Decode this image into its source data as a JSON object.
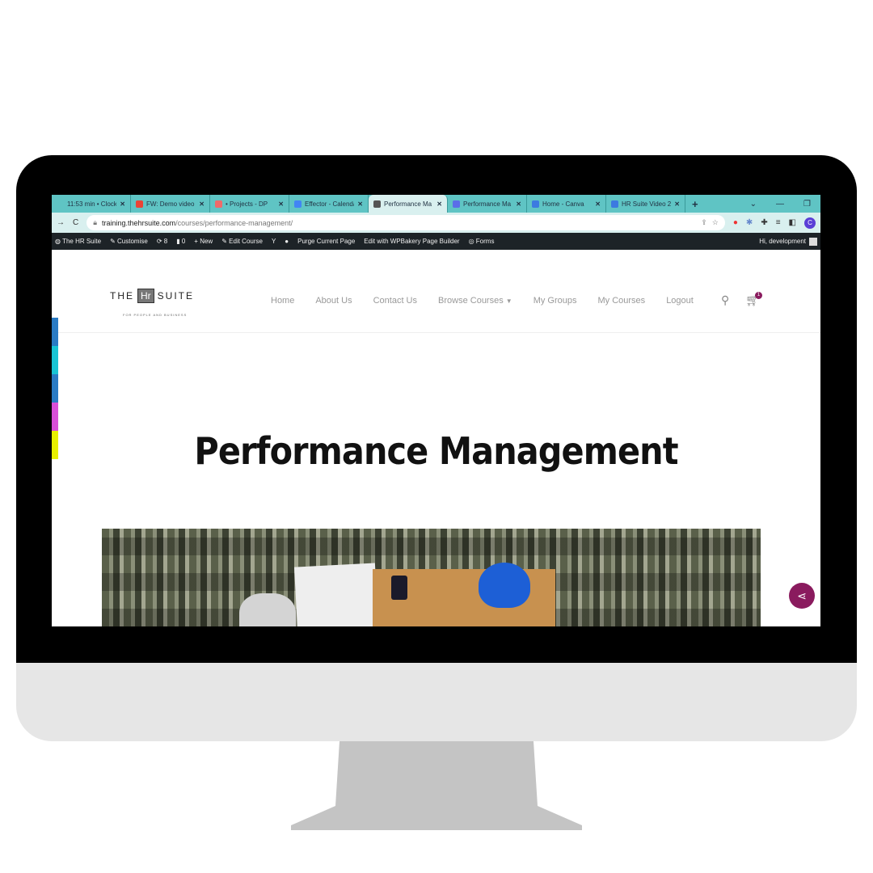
{
  "browser": {
    "tabs": [
      {
        "title": "11:53 min • Clock",
        "color": "#5fc4c4"
      },
      {
        "title": "FW: Demo video",
        "color": "#ea4335"
      },
      {
        "title": "• Projects - DP",
        "color": "#f06a6a"
      },
      {
        "title": "Effector - Calendar",
        "color": "#4285f4"
      },
      {
        "title": "Performance Ma",
        "color": "#555555",
        "active": true
      },
      {
        "title": "Performance Ma",
        "color": "#5b6ee8"
      },
      {
        "title": "Home - Canva",
        "color": "#3c7ae0"
      },
      {
        "title": "HR Suite Video 2",
        "color": "#3c7ae0"
      }
    ],
    "new_tab": "+",
    "url_host": "training.thehrsuite.com",
    "url_path": "/courses/performance-management/"
  },
  "admin_bar": {
    "site": "The HR Suite",
    "customise": "Customise",
    "updates": "8",
    "comments": "0",
    "new": "New",
    "edit_course": "Edit Course",
    "purge": "Purge Current Page",
    "wpbakery": "Edit with WPBakery Page Builder",
    "forms": "Forms",
    "greeting": "Hi, development"
  },
  "site": {
    "logo_the": "THE",
    "logo_hr": "Hr",
    "logo_suite": "SUITE",
    "tagline": "FOR PEOPLE AND BUSINESS",
    "nav": [
      "Home",
      "About Us",
      "Contact Us",
      "Browse Courses",
      "My Groups",
      "My Courses",
      "Logout"
    ],
    "cart_count": "1",
    "title": "Performance Management"
  },
  "colors": {
    "accent": "#8a1b5e",
    "tabbar": "#5fc4c4",
    "strip": [
      "#2a7bc4",
      "#19c4d4",
      "#2a7bc4",
      "#d94fd9",
      "#e8f000"
    ]
  }
}
